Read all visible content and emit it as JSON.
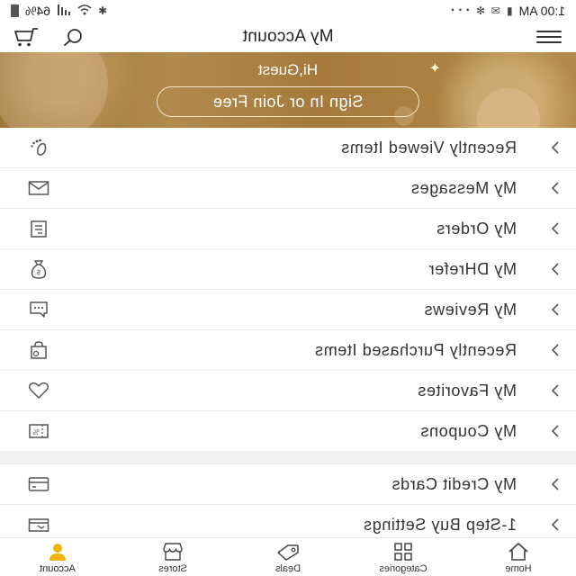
{
  "status_bar": {
    "time": "1:00 AM",
    "battery": "64%"
  },
  "header": {
    "title": "My Account"
  },
  "banner": {
    "greeting": "Hi,Guest",
    "signin_label": "Sign In or Join Free"
  },
  "menu_group_1": [
    {
      "label": "Recently Viewed Items",
      "icon": "footprint-icon"
    },
    {
      "label": "My Messages",
      "icon": "envelope-icon"
    },
    {
      "label": "My Orders",
      "icon": "order-list-icon"
    },
    {
      "label": "My DHrefer",
      "icon": "money-bag-icon"
    },
    {
      "label": "My Reviews",
      "icon": "chat-bubble-icon"
    },
    {
      "label": "Recently Purchased Items",
      "icon": "shopping-bag-icon"
    },
    {
      "label": "My Favorites",
      "icon": "heart-icon"
    },
    {
      "label": "My Coupons",
      "icon": "coupon-icon"
    }
  ],
  "menu_group_2": [
    {
      "label": "My Credit Cards",
      "icon": "credit-card-icon"
    },
    {
      "label": "1-Step Buy Settings",
      "icon": "one-step-buy-icon"
    }
  ],
  "bottom_nav": [
    {
      "label": "Home",
      "icon": "home-icon"
    },
    {
      "label": "Categories",
      "icon": "grid-icon"
    },
    {
      "label": "Deals",
      "icon": "tag-icon"
    },
    {
      "label": "Stores",
      "icon": "store-icon"
    },
    {
      "label": "Account",
      "icon": "person-icon",
      "active": true
    }
  ],
  "colors": {
    "banner_gold": "#a57a3c",
    "active_tab": "#f0b400"
  }
}
